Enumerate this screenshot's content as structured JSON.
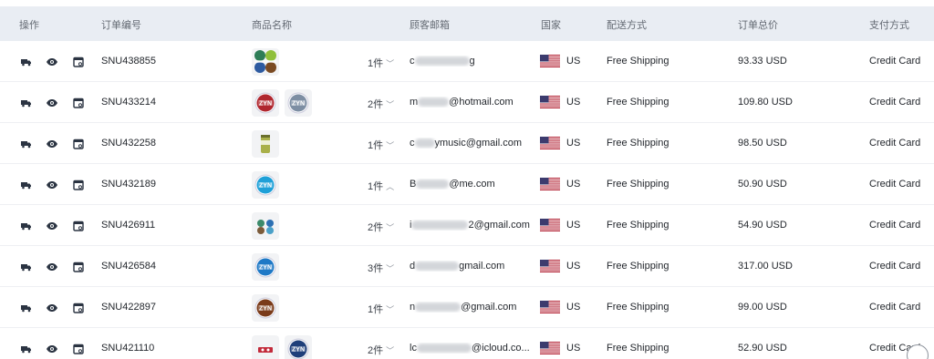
{
  "colors": {
    "header_bg": "#e9edf3",
    "flag_blue": "#3c3b6e",
    "flag_red": "#b22234",
    "icon_dark": "#2b3442"
  },
  "headers": {
    "actions": "操作",
    "order_no": "订单编号",
    "product": "商品名称",
    "email": "顾客邮箱",
    "country": "国家",
    "shipping": "配送方式",
    "total": "订单总价",
    "payment": "支付方式"
  },
  "row_icons": [
    "truck-icon",
    "eye-icon",
    "calendar-icon"
  ],
  "rows": [
    {
      "order": "SNU438855",
      "qty": "1件",
      "chev": "﹀",
      "email_pre": "c",
      "email_post": "g",
      "country": "US",
      "shipping": "Free Shipping",
      "total": "93.33 USD",
      "payment": "Credit Card",
      "thumbs": [
        "multi"
      ]
    },
    {
      "order": "SNU433214",
      "qty": "2件",
      "chev": "﹀",
      "email_pre": "m",
      "email_post": "@hotmail.com",
      "country": "US",
      "shipping": "Free Shipping",
      "total": "109.80 USD",
      "payment": "Credit Card",
      "thumbs": [
        "zyn-red",
        "zyn-gray"
      ]
    },
    {
      "order": "SNU432258",
      "qty": "1件",
      "chev": "﹀",
      "email_pre": "c",
      "email_post": "ymusic@gmail.com",
      "country": "US",
      "shipping": "Free Shipping",
      "total": "98.50 USD",
      "payment": "Credit Card",
      "thumbs": [
        "can"
      ]
    },
    {
      "order": "SNU432189",
      "qty": "1件",
      "chev": "︿",
      "email_pre": "B",
      "email_post": "@me.com",
      "country": "US",
      "shipping": "Free Shipping",
      "total": "50.90 USD",
      "payment": "Credit Card",
      "thumbs": [
        "zyn-blue"
      ]
    },
    {
      "order": "SNU426911",
      "qty": "2件",
      "chev": "﹀",
      "email_pre": "i",
      "email_post": "2@gmail.com",
      "country": "US",
      "shipping": "Free Shipping",
      "total": "54.90 USD",
      "payment": "Credit Card",
      "thumbs": [
        "multi-small"
      ]
    },
    {
      "order": "SNU426584",
      "qty": "3件",
      "chev": "﹀",
      "email_pre": "d",
      "email_post": "gmail.com",
      "country": "US",
      "shipping": "Free Shipping",
      "total": "317.00 USD",
      "payment": "Credit Card",
      "thumbs": [
        "zyn-blue2"
      ]
    },
    {
      "order": "SNU422897",
      "qty": "1件",
      "chev": "﹀",
      "email_pre": "n",
      "email_post": "@gmail.com",
      "country": "US",
      "shipping": "Free Shipping",
      "total": "99.00 USD",
      "payment": "Credit Card",
      "thumbs": [
        "zyn-brown"
      ]
    },
    {
      "order": "SNU421110",
      "qty": "2件",
      "chev": "﹀",
      "email_pre": "lc",
      "email_post": "@icloud.co...",
      "country": "US",
      "shipping": "Free Shipping",
      "total": "52.90 USD",
      "payment": "Credit Card",
      "thumbs": [
        "small-red",
        "zyn-navy"
      ]
    }
  ]
}
